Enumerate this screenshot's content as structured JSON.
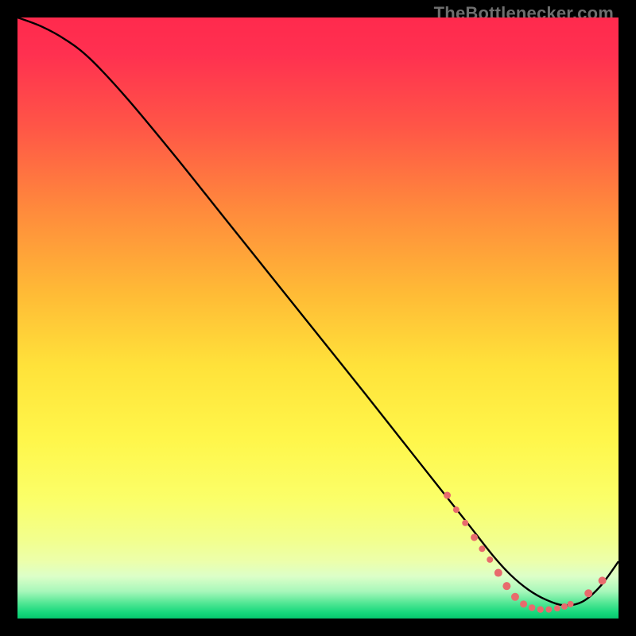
{
  "watermark": "TheBottlenecker.com",
  "chart_data": {
    "type": "line",
    "title": "",
    "xlabel": "",
    "ylabel": "",
    "xlim": [
      0,
      100
    ],
    "ylim": [
      0,
      100
    ],
    "grid": false,
    "series": [
      {
        "name": "curve",
        "x": [
          0,
          4,
          8,
          12,
          18,
          26,
          34,
          42,
          50,
          58,
          64,
          70,
          75,
          79,
          82,
          85,
          88,
          91,
          94,
          97,
          100
        ],
        "y": [
          100,
          98.5,
          96.3,
          93.2,
          86.8,
          77.2,
          67.2,
          57.2,
          47.2,
          37.2,
          29.6,
          22,
          15.7,
          10.6,
          7.3,
          4.8,
          3.1,
          2.2,
          2.8,
          5.4,
          9.5
        ]
      }
    ],
    "markers": {
      "name": "dots",
      "color": "#e86b6d",
      "points": [
        {
          "x": 71.5,
          "y": 20.5,
          "r": 4.5
        },
        {
          "x": 73.0,
          "y": 18.1,
          "r": 4.0
        },
        {
          "x": 74.5,
          "y": 15.9,
          "r": 4.0
        },
        {
          "x": 76.0,
          "y": 13.5,
          "r": 4.5
        },
        {
          "x": 77.3,
          "y": 11.6,
          "r": 4.0
        },
        {
          "x": 78.6,
          "y": 9.8,
          "r": 4.0
        },
        {
          "x": 80.0,
          "y": 7.6,
          "r": 5.0
        },
        {
          "x": 81.4,
          "y": 5.4,
          "r": 5.0
        },
        {
          "x": 82.8,
          "y": 3.6,
          "r": 5.0
        },
        {
          "x": 84.2,
          "y": 2.4,
          "r": 4.5
        },
        {
          "x": 85.6,
          "y": 1.8,
          "r": 4.2
        },
        {
          "x": 87.0,
          "y": 1.5,
          "r": 4.2
        },
        {
          "x": 88.4,
          "y": 1.5,
          "r": 4.0
        },
        {
          "x": 89.8,
          "y": 1.7,
          "r": 4.0
        },
        {
          "x": 91.0,
          "y": 2.0,
          "r": 4.0
        },
        {
          "x": 92.0,
          "y": 2.4,
          "r": 4.0
        },
        {
          "x": 95.0,
          "y": 4.2,
          "r": 5.0
        },
        {
          "x": 97.3,
          "y": 6.3,
          "r": 5.0
        }
      ]
    },
    "gradient_stops": [
      {
        "offset": 0.0,
        "color": "#ff2a4d"
      },
      {
        "offset": 0.06,
        "color": "#ff3050"
      },
      {
        "offset": 0.18,
        "color": "#ff5547"
      },
      {
        "offset": 0.32,
        "color": "#ff8a3c"
      },
      {
        "offset": 0.46,
        "color": "#ffbb36"
      },
      {
        "offset": 0.58,
        "color": "#ffe23a"
      },
      {
        "offset": 0.7,
        "color": "#fff64a"
      },
      {
        "offset": 0.8,
        "color": "#fbff68"
      },
      {
        "offset": 0.87,
        "color": "#f2ff8e"
      },
      {
        "offset": 0.905,
        "color": "#ecffab"
      },
      {
        "offset": 0.93,
        "color": "#dcffc8"
      },
      {
        "offset": 0.955,
        "color": "#a7f7ba"
      },
      {
        "offset": 0.975,
        "color": "#4fe693"
      },
      {
        "offset": 0.99,
        "color": "#17d87c"
      },
      {
        "offset": 1.0,
        "color": "#06c76e"
      }
    ]
  }
}
